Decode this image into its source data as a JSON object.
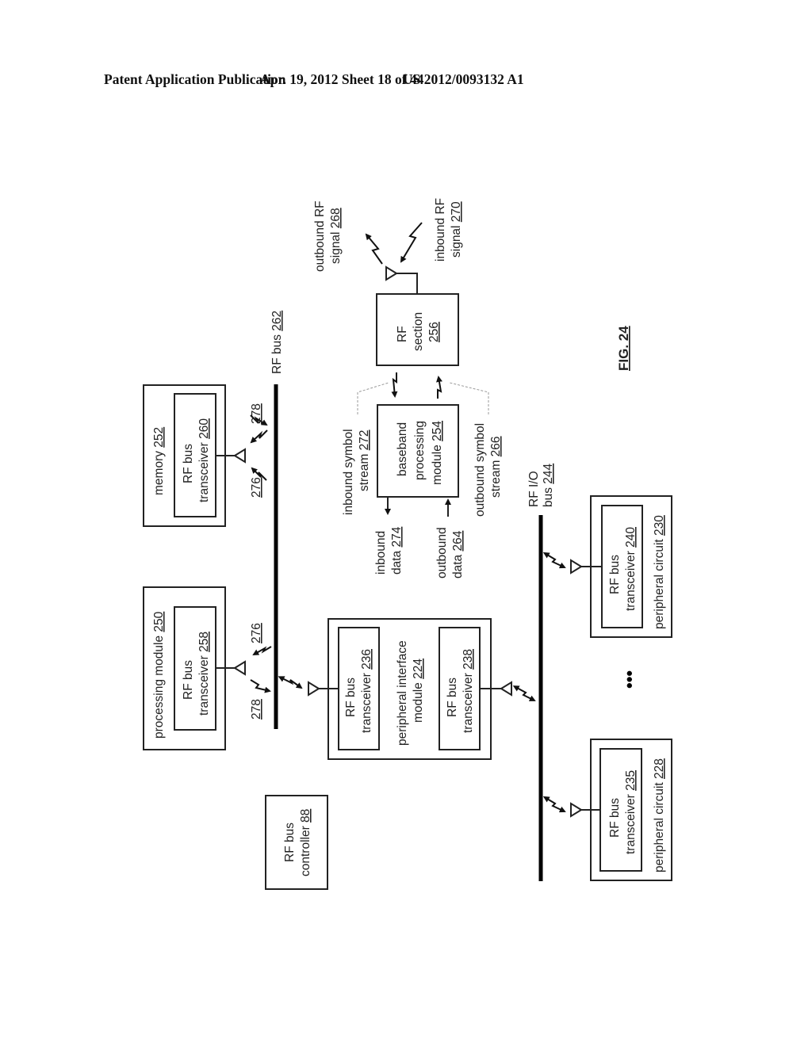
{
  "header": {
    "left": "Patent Application Publication",
    "middle": "Apr. 19, 2012  Sheet 18 of 44",
    "right": "US 2012/0093132 A1"
  },
  "figure": {
    "label": "FIG. 24",
    "rf_bus": {
      "text": "RF bus",
      "ref": "262"
    },
    "rf_io_bus": {
      "line1": "RF I/O",
      "line2": "bus",
      "ref": "244"
    },
    "memory": {
      "label": "memory",
      "ref": "252",
      "transceiver": {
        "line1": "RF bus",
        "line2": "transceiver",
        "ref": "260"
      }
    },
    "processing_module": {
      "label": "processing module",
      "ref": "250",
      "transceiver": {
        "line1": "RF bus",
        "line2": "transceiver",
        "ref": "258"
      }
    },
    "rf_bus_controller": {
      "line1": "RF bus",
      "line2": "controller",
      "ref": "88"
    },
    "peripheral_interface": {
      "line1": "peripheral interface",
      "line2": "module",
      "ref": "224",
      "transceiver_a": {
        "line1": "RF bus",
        "line2": "transceiver",
        "ref": "236"
      },
      "transceiver_b": {
        "line1": "RF bus",
        "line2": "transceiver",
        "ref": "238"
      }
    },
    "peripheral_230": {
      "label": "peripheral circuit",
      "ref": "230",
      "transceiver": {
        "line1": "RF bus",
        "line2": "transceiver",
        "ref": "240"
      }
    },
    "peripheral_228": {
      "label": "peripheral circuit",
      "ref": "228",
      "transceiver": {
        "line1": "RF bus",
        "line2": "transceiver",
        "ref": "235"
      }
    },
    "baseband": {
      "line1": "baseband",
      "line2": "processing",
      "line3": "module",
      "ref": "254"
    },
    "rf_section": {
      "line1": "RF",
      "line2": "section",
      "ref": "256"
    },
    "inbound_symbol": {
      "line1": "inbound symbol",
      "line2": "stream",
      "ref": "272"
    },
    "outbound_symbol": {
      "line1": "outbound symbol",
      "line2": "stream",
      "ref": "266"
    },
    "inbound_data": {
      "line1": "inbound",
      "line2": "data",
      "ref": "274"
    },
    "outbound_data": {
      "line1": "outbound",
      "line2": "data",
      "ref": "264"
    },
    "outbound_rf": {
      "line1": "outbound RF",
      "line2": "signal",
      "ref": "268"
    },
    "inbound_rf": {
      "line1": "inbound RF",
      "line2": "signal",
      "ref": "270"
    },
    "signal_refs": {
      "a": "276",
      "b": "278"
    },
    "ellipsis": "•••"
  }
}
